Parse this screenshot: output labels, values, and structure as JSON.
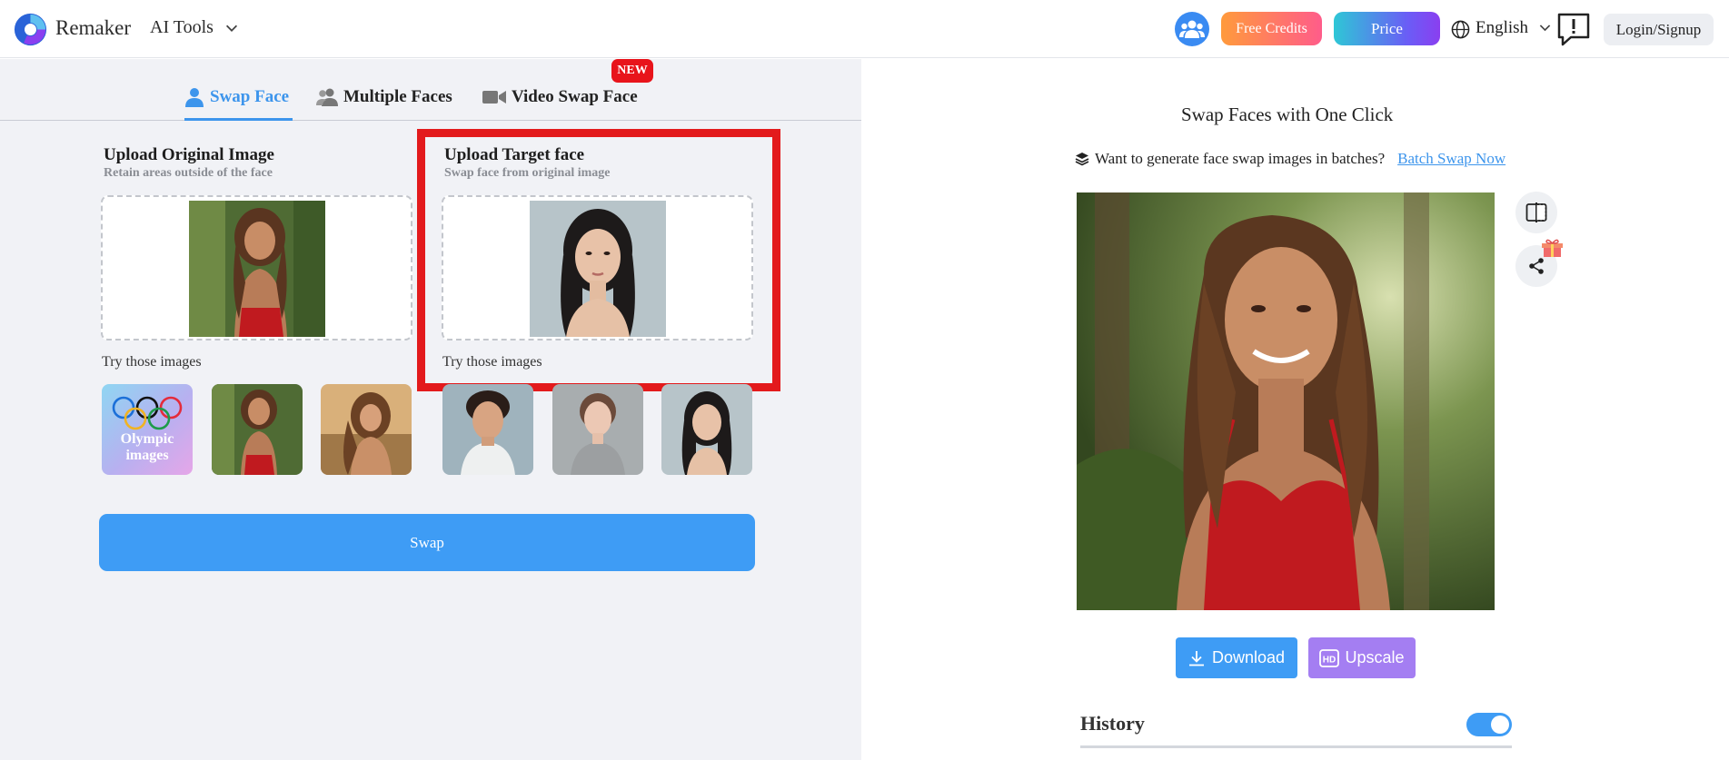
{
  "header": {
    "brand": "Remaker",
    "ai_tools": "AI Tools",
    "free_credits": "Free Credits",
    "price": "Price",
    "language": "English",
    "login": "Login/Signup"
  },
  "tabs": [
    {
      "label": "Swap Face",
      "active": true
    },
    {
      "label": "Multiple Faces",
      "active": false
    },
    {
      "label": "Video Swap Face",
      "active": false
    }
  ],
  "new_badge": "NEW",
  "original": {
    "title": "Upload Original Image",
    "subtitle": "Retain areas outside of the face",
    "try_label": "Try those images"
  },
  "target": {
    "title": "Upload Target face",
    "subtitle": "Swap face from original image",
    "try_label": "Try those images"
  },
  "olympic_label": "Olympic images",
  "swap_button": "Swap",
  "right": {
    "title": "Swap Faces with One Click",
    "batch_text": "Want to generate face swap images in batches?",
    "batch_link": "Batch Swap Now",
    "download": "Download",
    "upscale": "Upscale",
    "history": "History",
    "history_toggle_on": true
  },
  "colors": {
    "accent": "#3d95ec",
    "highlight": "#e31a1c",
    "new_badge": "#e8141b",
    "upscale": "#a47ef2"
  }
}
